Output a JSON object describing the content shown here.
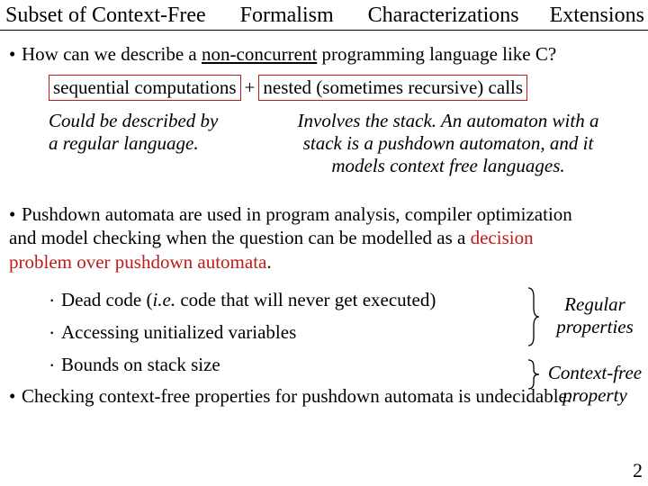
{
  "header": {
    "t1": "Subset of Context-Free",
    "t2": "Formalism",
    "t3": "Characterizations",
    "t4": "Extensions"
  },
  "bullet1": {
    "pre": "How can we describe a ",
    "nonconc": "non-concurrent",
    "post": " programming language like C?"
  },
  "boxes": {
    "seq": "sequential computations",
    "plus": "+",
    "nested": "nested (sometimes recursive) calls"
  },
  "expl": {
    "left1": "Could be described by",
    "left2": "a regular language.",
    "right1": "Involves the stack. An automaton with a",
    "right2": "stack is a pushdown automaton, and it",
    "right3": "models context free languages."
  },
  "bullet2": {
    "l1a": "Pushdown automata are used in program analysis, compiler optimization",
    "l2a": "and model checking when the question can be modelled as a ",
    "l2b": "decision",
    "l3a": "problem over pushdown automata",
    "l3b": "."
  },
  "examples": {
    "e1a": "Dead code (",
    "e1b": "i.e.",
    "e1c": " code that will never get executed)",
    "e2": "Accessing unitialized variables",
    "e3": "Bounds on stack size",
    "lab1a": "Regular",
    "lab1b": "properties",
    "lab2a": "Context-free",
    "lab2b": "property"
  },
  "final": {
    "t": "Checking context-free properties for pushdown automata is undecidable."
  },
  "pagenum": "2"
}
